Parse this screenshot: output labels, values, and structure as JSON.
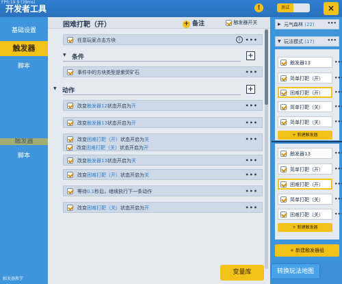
{
  "topbar": {
    "fps": "FPS:19.9 (39ms)",
    "title": "开发者工具",
    "warn_icon": "!",
    "toggle_label": "测试",
    "close_icon": "×"
  },
  "sidebar": {
    "items": [
      {
        "label": "基础设置"
      },
      {
        "label": "触发器"
      },
      {
        "label": "脚本"
      },
      {
        "label": "触发器"
      },
      {
        "label": "脚本"
      }
    ],
    "footer": "触发器教学"
  },
  "main": {
    "title": "困难打靶（开）",
    "note_label": "备注",
    "note_plus": "+",
    "switch_label": "触发器开关",
    "trigger_event": "任意玩家点击方块",
    "info_icon": "i",
    "more_icon": "•••",
    "sections": {
      "conditions": {
        "title": "条件",
        "add": "+",
        "arrow": "▼"
      },
      "actions": {
        "title": "动作",
        "add": "+",
        "arrow": "▼"
      }
    },
    "condition_rows": [
      {
        "pre": "事件中的方块类型是紫荧矿石",
        "hl": "",
        "post": ""
      }
    ],
    "action_rows": [
      {
        "p1": "改变",
        "h1": "触发器12",
        "p2": "状态开启为",
        "h2": "开"
      },
      {
        "p1": "改变",
        "h1": "触发器13",
        "p2": "状态开启为",
        "h2": "开"
      },
      {
        "p1": "改变",
        "h1": "困难打靶（开）",
        "p2": "状态开启为",
        "h2": "关"
      },
      {
        "p1": "改变",
        "h1": "困难打靶（关）",
        "p2": "状态开启为",
        "h2": "开"
      },
      {
        "p1": "改变",
        "h1": "触发器13",
        "p2": "状态开启为",
        "h2": "关"
      },
      {
        "p1": "改变",
        "h1": "困难打靶（开）",
        "p2": "状态开启为",
        "h2": "关"
      },
      {
        "p1": "等待",
        "h1": "0.1",
        "p2": "秒后，继续执行下一条动作",
        "h2": ""
      },
      {
        "p1": "改变",
        "h1": "困难打靶（关）",
        "p2": "状态开启为",
        "h2": "开"
      }
    ]
  },
  "bottom": {
    "variable_lib": "变量库",
    "switch_map": "转换玩法地图"
  },
  "right": {
    "groups": [
      {
        "name": "元气森林",
        "count": "(22)",
        "arrow": "▶",
        "more": "•••"
      },
      {
        "name": "玩法模式",
        "count": "(17)",
        "arrow": "▼",
        "more": "•••"
      }
    ],
    "triggers_a": [
      {
        "label": "触发器13"
      },
      {
        "label": "简单打靶（开）"
      },
      {
        "label": "困难打靶（开）"
      },
      {
        "label": "简单打靶（关）"
      },
      {
        "label": "简单打靶（关）"
      }
    ],
    "triggers_b": [
      {
        "label": "触发器13"
      },
      {
        "label": "简单打靶（开）"
      },
      {
        "label": "困难打靶（开）"
      },
      {
        "label": "简单打靶（关）"
      },
      {
        "label": "困难打靶（关）"
      }
    ],
    "more_icon": "•••",
    "new_trigger": "+ 新建触发器",
    "new_group": "+ 新建触发器组"
  },
  "colors": {
    "accent": "#f2c21a",
    "primary_blue": "#3d8fd6",
    "highlight_text": "#2f7fd0"
  }
}
